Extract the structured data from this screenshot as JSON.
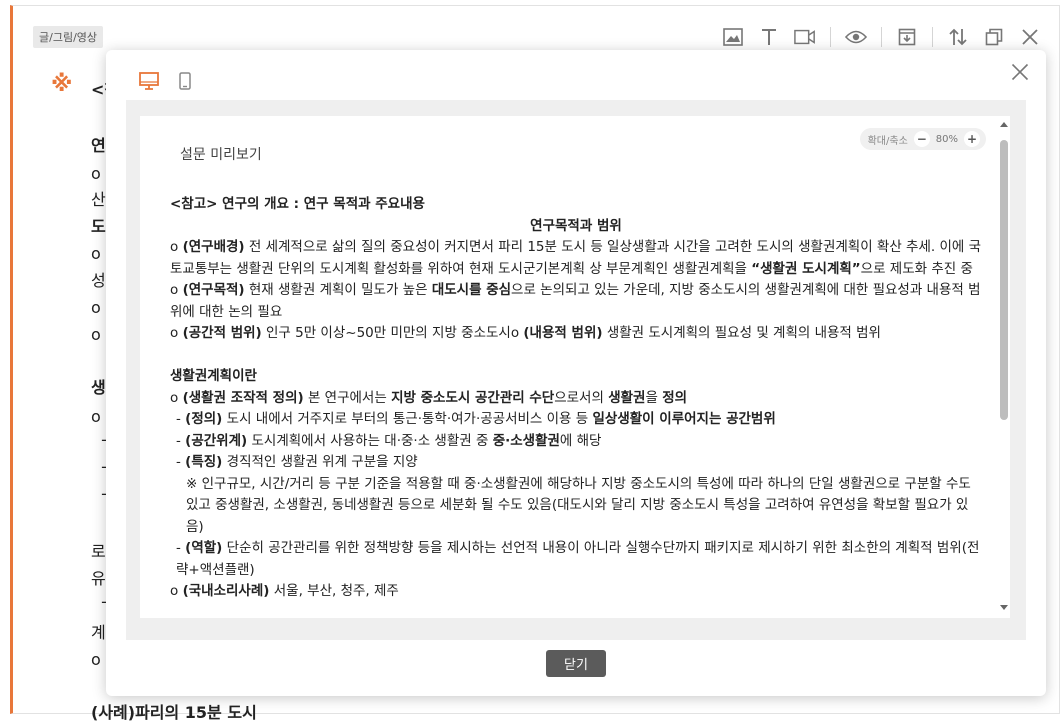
{
  "editor": {
    "tag": "글/그림/영상",
    "note_symbol": "※",
    "lines": [
      {
        "text": "<참",
        "bold": true
      },
      {
        "text": "연구",
        "bold": true
      },
      {
        "text": "o (연",
        "bold": false
      },
      {
        "text": "산 추",
        "bold": false
      },
      {
        "text": "도시",
        "bold": true
      },
      {
        "text": "o (연",
        "bold": false
      },
      {
        "text": "성고",
        "bold": false
      },
      {
        "text": "o (공",
        "bold": false
      },
      {
        "text": "o (내",
        "bold": false
      },
      {
        "text": "생활",
        "bold": true
      },
      {
        "text": "o (생",
        "bold": false
      },
      {
        "text": "  - (",
        "bold": false
      },
      {
        "text": "  - (",
        "bold": false
      },
      {
        "text": "  - (",
        "bold": false
      },
      {
        "text": "    ※",
        "bold": false
      },
      {
        "text": "로 구",
        "bold": false
      },
      {
        "text": "유연",
        "bold": false
      },
      {
        "text": "  - (",
        "bold": false
      },
      {
        "text": "계획",
        "bold": false
      },
      {
        "text": "o (국",
        "bold": false
      },
      {
        "text": "(사례)파리의 15분 도시",
        "bold": true
      }
    ]
  },
  "preview": {
    "title": "설문 미리보기",
    "zoom_label": "확대/축소",
    "zoom_value": "80%",
    "zoom_minus": "−",
    "zoom_plus": "+",
    "close_label": "닫기",
    "paragraphs": [
      {
        "cls": "b",
        "segs": [
          {
            "t": "<참고> 연구의 개요 : 연구 목적과 주요내용",
            "b": true
          }
        ]
      },
      {
        "cls": "center",
        "segs": [
          {
            "t": "연구목적과 범위",
            "b": true
          }
        ]
      },
      {
        "cls": "",
        "segs": [
          {
            "t": "o ",
            "b": false
          },
          {
            "t": "(연구배경)",
            "b": true
          },
          {
            "t": " 전 세계적으로 삶의 질의 중요성이 커지면서 파리 15분 도시 등 일상생활과 시간을 고려한 도시의 생활권계획이 확산 추세. 이에 국토교통부는 생활권 단위의 도시계획 활성화를 위하여 현재 도시군기본계획 상 부문계획인 생활권계획을 ",
            "b": false
          },
          {
            "t": "“생활권 도시계획”",
            "b": true
          },
          {
            "t": "으로 제도화 추진 중",
            "b": false
          }
        ]
      },
      {
        "cls": "",
        "segs": [
          {
            "t": "o ",
            "b": false
          },
          {
            "t": "(연구목적)",
            "b": true
          },
          {
            "t": " 현재 생활권 계획이 밀도가 높은 ",
            "b": false
          },
          {
            "t": "대도시를 중심",
            "b": true
          },
          {
            "t": "으로 논의되고 있는 가운데, 지방 중소도시의 생활권계획에 대한 필요성과 내용적 범위에 대한 논의 필요",
            "b": false
          }
        ]
      },
      {
        "cls": "",
        "segs": [
          {
            "t": "o ",
            "b": false
          },
          {
            "t": "(공간적 범위)",
            "b": true
          },
          {
            "t": " 인구 5만 이상~50만 미만의 지방 중소도시o ",
            "b": false
          },
          {
            "t": "(내용적 범위)",
            "b": true
          },
          {
            "t": " 생활권 도시계획의 필요성 및 계획의 내용적 범위",
            "b": false
          }
        ]
      },
      {
        "cls": "gap",
        "segs": []
      },
      {
        "cls": "b",
        "segs": [
          {
            "t": "생활권계획이란",
            "b": true
          }
        ]
      },
      {
        "cls": "",
        "segs": [
          {
            "t": "o ",
            "b": false
          },
          {
            "t": "(생활권 조작적 정의)",
            "b": true
          },
          {
            "t": " 본 연구에서는 ",
            "b": false
          },
          {
            "t": "지방 중소도시 공간관리 수단",
            "b": true
          },
          {
            "t": "으로서의 ",
            "b": false
          },
          {
            "t": "생활권",
            "b": true
          },
          {
            "t": "을 ",
            "b": false
          },
          {
            "t": "정의",
            "b": true
          }
        ]
      },
      {
        "cls": "ind1",
        "segs": [
          {
            "t": "- ",
            "b": false
          },
          {
            "t": "(정의)",
            "b": true
          },
          {
            "t": " 도시 내에서 거주지로 부터의 통근·통학·여가·공공서비스 이용 등 ",
            "b": false
          },
          {
            "t": "일상생활이 이루어지는 공간범위",
            "b": true
          }
        ]
      },
      {
        "cls": "ind1",
        "segs": [
          {
            "t": "- ",
            "b": false
          },
          {
            "t": "(공간위계)",
            "b": true
          },
          {
            "t": " 도시계획에서 사용하는 대·중·소 생활권 중 ",
            "b": false
          },
          {
            "t": "중·소생활권",
            "b": true
          },
          {
            "t": "에 해당",
            "b": false
          }
        ]
      },
      {
        "cls": "ind1",
        "segs": [
          {
            "t": "- ",
            "b": false
          },
          {
            "t": "(특징)",
            "b": true
          },
          {
            "t": " 경직적인 생활권 위계 구분을 지양",
            "b": false
          }
        ]
      },
      {
        "cls": "ind2",
        "segs": [
          {
            "t": "※ 인구규모, 시간/거리 등 구분 기준을 적용할 때 중·소생활권에 해당하나 지방 중소도시의 특성에 따라 하나의 단일 생활권으로 구분할 수도 있고 중생활권, 소생활권, 동네생활권 등으로 세분화 될 수도 있음(대도시와 달리 지방 중소도시 특성을 고려하여 유연성을 확보할 필요가 있음)",
            "b": false
          }
        ]
      },
      {
        "cls": "ind1",
        "segs": [
          {
            "t": "- ",
            "b": false
          },
          {
            "t": "(역할)",
            "b": true
          },
          {
            "t": " 단순히 공간관리를 위한 정책방향 등을 제시하는 선언적 내용이 아니라 실행수단까지 패키지로 제시하기 위한 최소한의 계획적 범위(전략+액션플랜)",
            "b": false
          }
        ]
      },
      {
        "cls": "",
        "segs": [
          {
            "t": "o ",
            "b": false
          },
          {
            "t": "(국내소리사례)",
            "b": true
          },
          {
            "t": " 서울, 부산, 청주, 제주",
            "b": false
          }
        ]
      }
    ]
  },
  "colors": {
    "accent": "#e8773a",
    "close_button_bg": "#5b5b5b"
  },
  "icons": {
    "toolbar": [
      "image-icon",
      "text-icon",
      "video-icon",
      "eye-icon",
      "archive-icon",
      "sort-icon",
      "copy-icon",
      "close-icon"
    ],
    "modes": [
      "desktop-icon",
      "mobile-icon"
    ]
  }
}
